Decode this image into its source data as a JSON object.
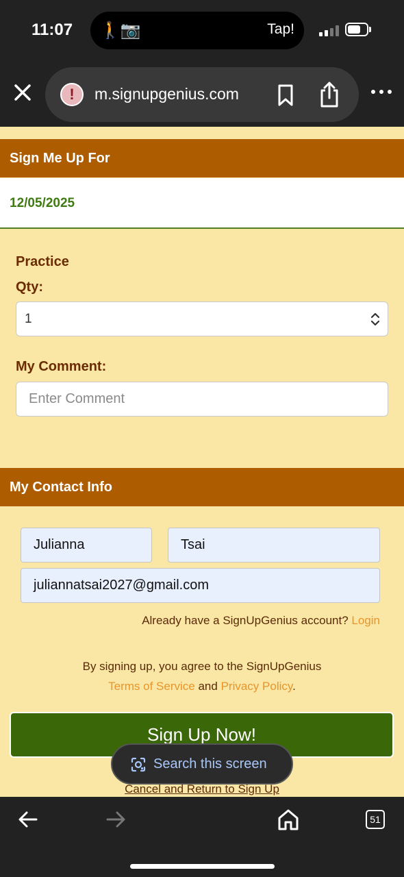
{
  "status_bar": {
    "time": "11:07",
    "activity_icons": "🚶📷",
    "back_label": "Tap!"
  },
  "browser": {
    "url": "m.signupgenius.com",
    "tab_count": "51"
  },
  "sign_up_section": {
    "header": "Sign Me Up For",
    "date": "12/05/2025",
    "slot_name": "Practice",
    "qty_label": "Qty:",
    "qty_value": "1",
    "comment_label": "My Comment:",
    "comment_placeholder": "Enter Comment"
  },
  "contact_section": {
    "header": "My Contact Info",
    "first_name": "Julianna",
    "last_name": "Tsai",
    "email": "juliannatsai2027@gmail.com",
    "account_prompt": "Already have a SignUpGenius account?",
    "login_link": "Login"
  },
  "terms": {
    "line1": "By signing up, you agree to the SignUpGenius",
    "terms_link": "Terms of Service",
    "and_text": "and",
    "privacy_link": "Privacy Policy",
    "period": "."
  },
  "actions": {
    "signup_button": "Sign Up Now!",
    "cancel_link": "Cancel and Return to Sign Up"
  },
  "overlay": {
    "search_screen": "Search this screen"
  },
  "colors": {
    "page_bg": "#fae7a6",
    "header_bg": "#ad5c00",
    "date_green": "#3f7a12",
    "button_green": "#3a6708",
    "link_orange": "#e8952a"
  }
}
